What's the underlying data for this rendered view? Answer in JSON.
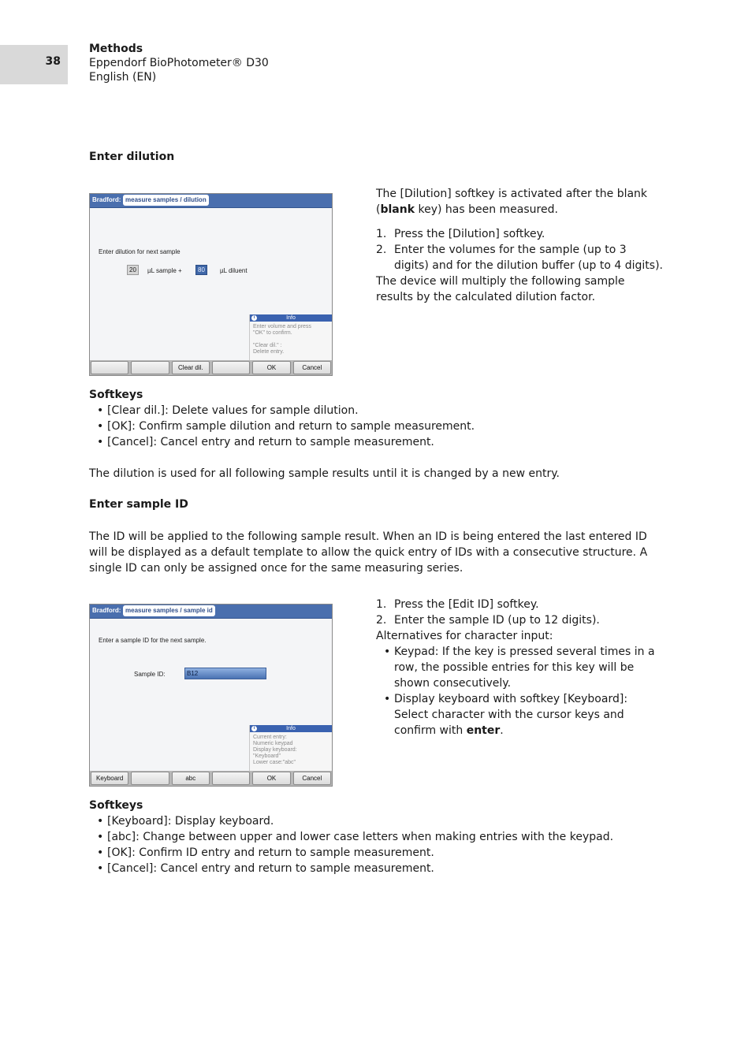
{
  "header": {
    "page_number": "38",
    "section": "Methods",
    "product": "Eppendorf BioPhotometer® D30",
    "language": "English (EN)"
  },
  "dilution": {
    "heading": "Enter dilution",
    "screen": {
      "app_name": "Bradford:",
      "breadcrumb": "measure samples / dilution",
      "prompt": "Enter dilution for next sample",
      "sample_value": "20",
      "sample_label": "µL sample +",
      "diluent_value": "80",
      "diluent_label": "µL diluent",
      "info_title": "Info",
      "info_lines": [
        "Enter volume and press",
        "\"OK\" to confirm.",
        "",
        "\"Clear dil.\" :",
        "Delete entry."
      ],
      "softkeys": [
        "",
        "",
        "Clear dil.",
        "",
        "OK",
        "Cancel"
      ]
    },
    "intro": {
      "text_before": "The [Dilution] softkey is activated after the blank (",
      "bold": "blank",
      "text_after": " key) has been measured."
    },
    "steps": [
      "Press the [Dilution] softkey.",
      "Enter the volumes for the sample (up to 3 digits) and for the dilution buffer (up to 4 digits)."
    ],
    "result_text": "The device will multiply the following sample results by the calculated dilution factor.",
    "softkeys_heading": "Softkeys",
    "softkey_descriptions": [
      "[Clear dil.]: Delete values for sample dilution.",
      "[OK]: Confirm sample dilution and return to sample measurement.",
      "[Cancel]: Cancel entry and return to sample measurement."
    ],
    "note": "The dilution is used for all following sample results until it is changed by a new entry."
  },
  "sample_id": {
    "heading": "Enter sample ID",
    "intro": "The ID will be applied to the following sample result. When an ID is being entered the last entered ID will be displayed as a default template to allow the quick entry of IDs with a consecutive structure. A single ID can only be assigned once for the same measuring series.",
    "screen": {
      "app_name": "Bradford:",
      "breadcrumb": "measure samples / sample id",
      "prompt": "Enter a sample ID for the next sample.",
      "field_label": "Sample ID:",
      "field_value": "B12",
      "info_title": "Info",
      "info_lines": [
        "Current entry:",
        "Numeric keypad",
        "Display keyboard:",
        "\"Keyboard\"",
        "Lower case:\"abc\""
      ],
      "softkeys": [
        "Keyboard",
        "",
        "abc",
        "",
        "OK",
        "Cancel"
      ]
    },
    "steps": [
      "Press the [Edit ID] softkey.",
      "Enter the sample ID (up to 12 digits)."
    ],
    "alternatives_label": "Alternatives for character input:",
    "alternatives": [
      {
        "text": "Keypad: If the key is pressed several times in a row, the possible entries for this key will be shown consecutively."
      },
      {
        "text_before": "Display keyboard with softkey [Keyboard]: Select character with the cursor keys and confirm with ",
        "bold": "enter",
        "text_after": "."
      }
    ],
    "softkeys_heading": "Softkeys",
    "softkey_descriptions": [
      "[Keyboard]: Display keyboard.",
      "[abc]: Change between upper and lower case letters when making entries with the keypad.",
      "[OK]: Confirm ID entry and return to sample measurement.",
      "[Cancel]: Cancel entry and return to sample measurement."
    ]
  }
}
